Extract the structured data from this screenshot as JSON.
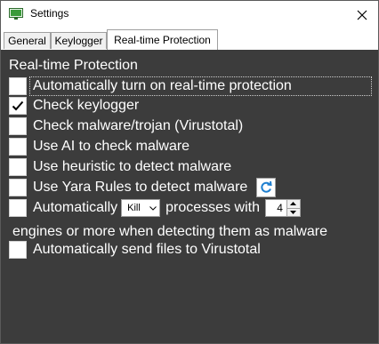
{
  "window": {
    "title": "Settings"
  },
  "tabs": [
    {
      "label": "General",
      "active": false
    },
    {
      "label": "Keylogger",
      "active": false
    },
    {
      "label": "Real-time Protection",
      "active": true
    }
  ],
  "section": {
    "title": "Real-time Protection"
  },
  "options": {
    "auto_rtp": {
      "label": "Automatically turn on real-time protection",
      "checked": false
    },
    "keylogger": {
      "label": "Check keylogger",
      "checked": true
    },
    "virustotal_check": {
      "label": "Check malware/trojan (Virustotal)",
      "checked": false
    },
    "ai": {
      "label": "Use AI to check malware",
      "checked": false
    },
    "heuristic": {
      "label": "Use heuristic to detect malware",
      "checked": false
    },
    "yara": {
      "label": "Use Yara Rules to detect malware",
      "checked": false
    },
    "auto_kill": {
      "prefix": "Automatically",
      "action": "Kill",
      "middle": "processes with",
      "engines": "4",
      "suffix": "engines or more when detecting them as malware",
      "checked": false
    },
    "auto_send": {
      "label": "Automatically send files to Virustotal",
      "checked": false
    }
  },
  "colors": {
    "background": "#3c3c3c",
    "text": "#ffffff",
    "accent": "#1e7fd0"
  }
}
